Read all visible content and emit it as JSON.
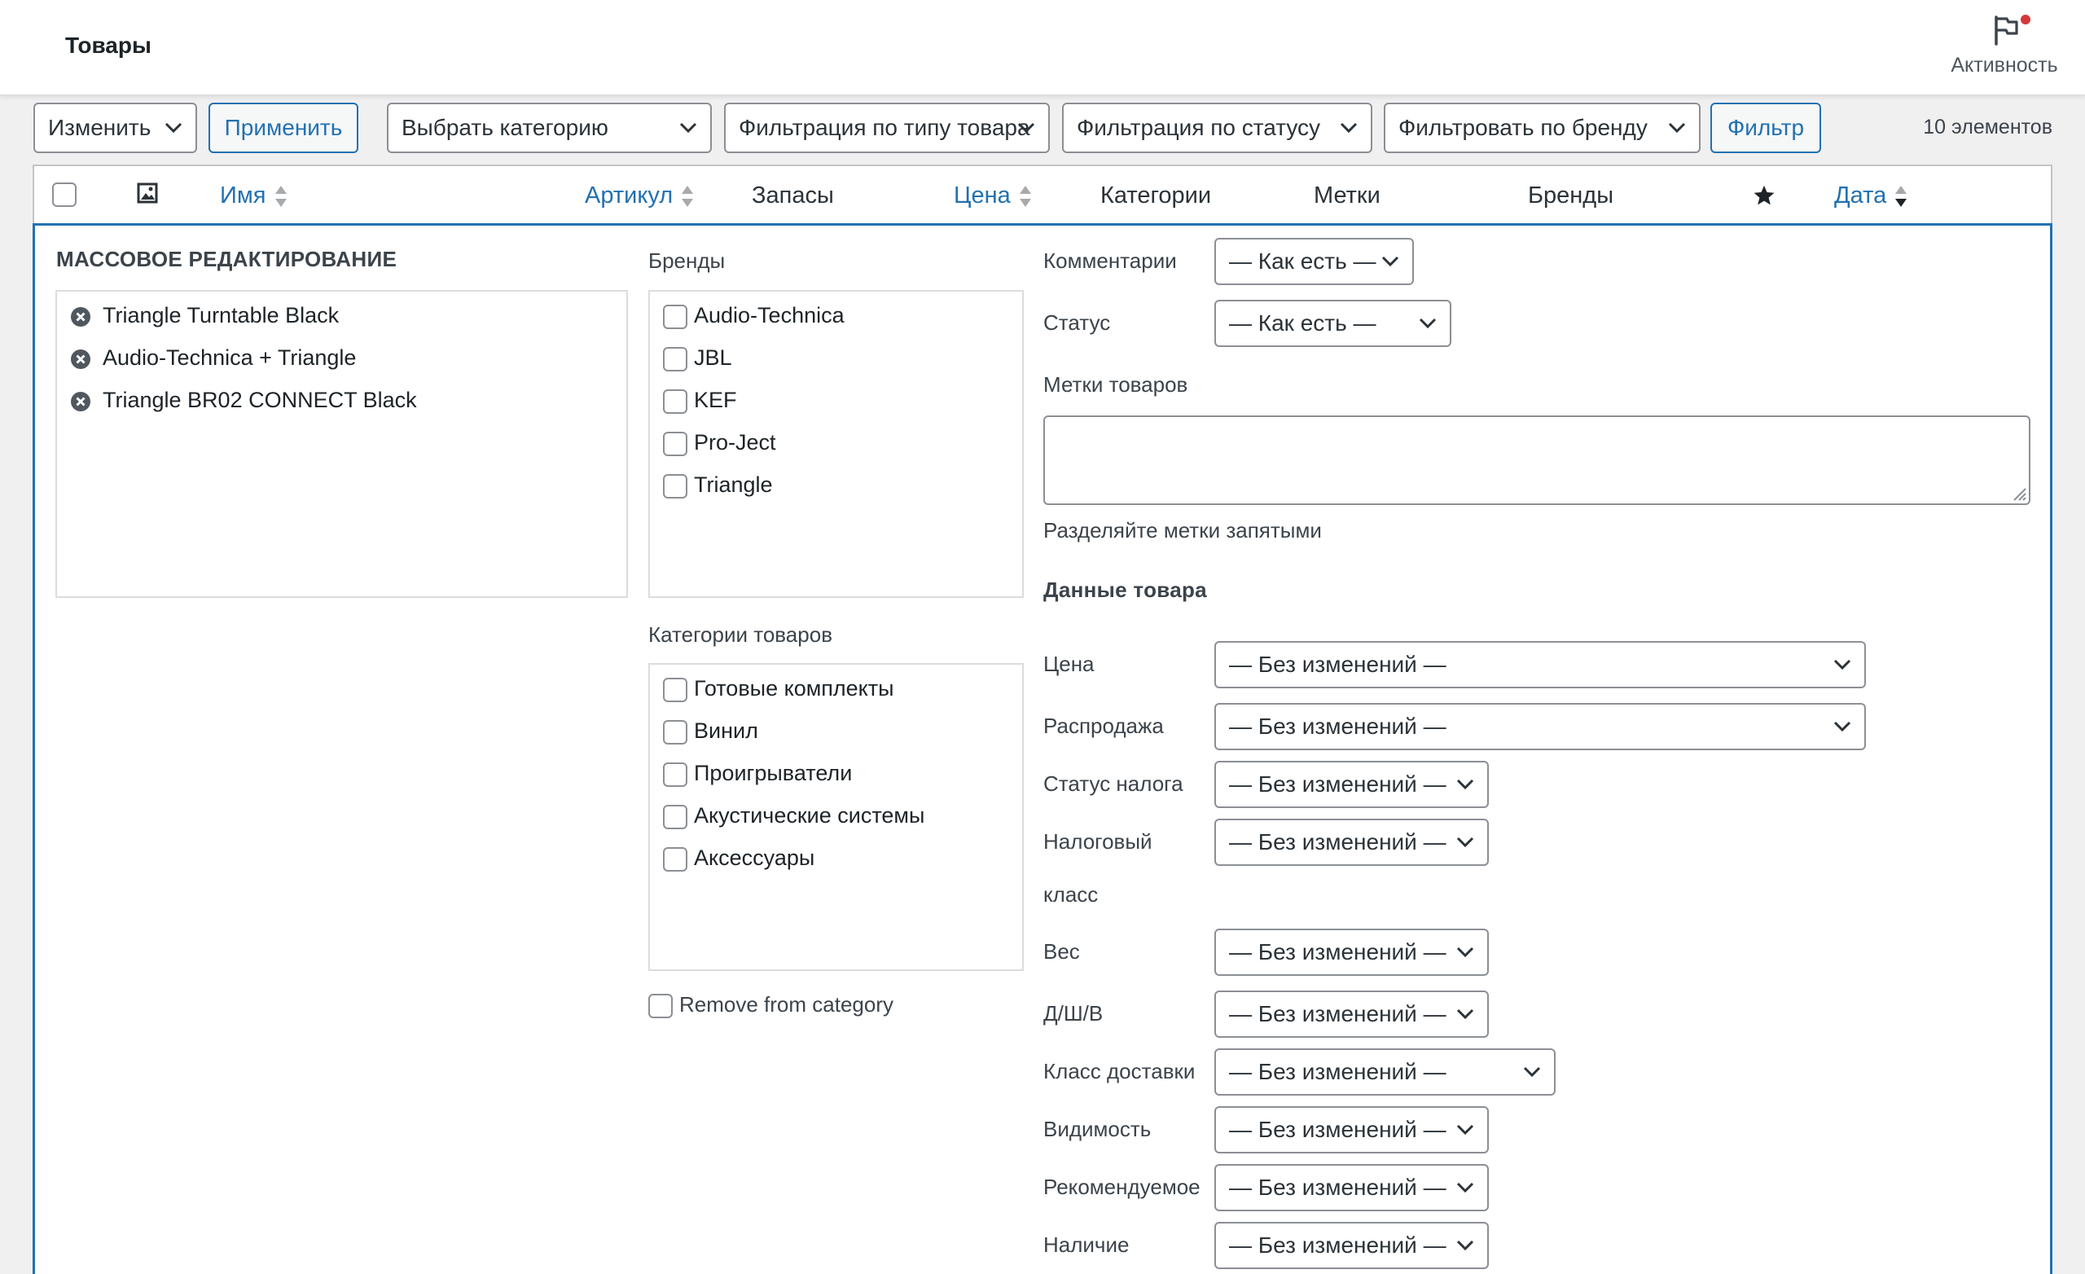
{
  "header": {
    "title": "Товары",
    "activity_label": "Активность"
  },
  "toolbar": {
    "bulk_action": "Изменить",
    "apply_label": "Применить",
    "category_select": "Выбрать категорию",
    "type_filter": "Фильтрация по типу товара",
    "status_filter": "Фильтрация по статусу",
    "brand_filter": "Фильтровать по бренду",
    "filter_label": "Фильтр",
    "items_count": "10 элементов"
  },
  "table": {
    "columns": {
      "name": "Имя",
      "sku": "Артикул",
      "stock": "Запасы",
      "price": "Цена",
      "categories": "Категории",
      "tags": "Метки",
      "brands": "Бренды",
      "date": "Дата"
    }
  },
  "bulk_edit": {
    "title": "МАССОВОЕ РЕДАКТИРОВАНИЕ",
    "items": [
      "Triangle Turntable Black",
      "Audio-Technica + Triangle",
      "Triangle BR02 CONNECT Black"
    ],
    "brands_label": "Бренды",
    "brands": [
      "Audio-Technica",
      "JBL",
      "KEF",
      "Pro-Ject",
      "Triangle"
    ],
    "categories_label": "Категории товаров",
    "categories": [
      "Готовые комплекты",
      "Винил",
      "Проигрыватели",
      "Акустические системы",
      "Аксессуары"
    ],
    "remove_from_category": "Remove from category",
    "comments_label": "Комментарии",
    "comments_value": "— Как есть —",
    "status_label": "Статус",
    "status_value": "— Как есть —",
    "tags_label": "Метки товаров",
    "tags_hint": "Разделяйте метки запятыми",
    "product_data_title": "Данные товара",
    "fields": {
      "price": {
        "label": "Цена",
        "value": "— Без изменений —"
      },
      "sale": {
        "label": "Распродажа",
        "value": "— Без изменений —"
      },
      "tax_status": {
        "label": "Статус налога",
        "value": "— Без изменений —"
      },
      "tax_class": {
        "label_line1": "Налоговый",
        "label_line2": "класс",
        "value": "— Без изменений —"
      },
      "weight": {
        "label": "Вес",
        "value": "— Без изменений —"
      },
      "dimensions": {
        "label": "Д/Ш/В",
        "value": "— Без изменений —"
      },
      "shipping_class": {
        "label": "Класс доставки",
        "value": "— Без изменений —"
      },
      "visibility": {
        "label": "Видимость",
        "value": "— Без изменений —"
      },
      "featured": {
        "label": "Рекомендуемое",
        "value": "— Без изменений —"
      },
      "stock": {
        "label": "Наличие",
        "value": "— Без изменений —"
      }
    }
  }
}
